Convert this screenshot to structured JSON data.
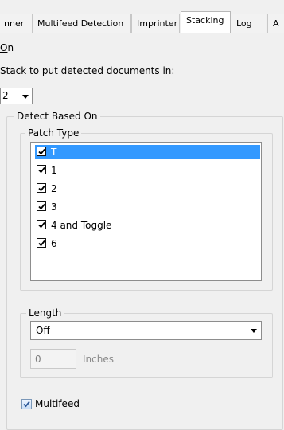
{
  "tabs": [
    {
      "label": "nner"
    },
    {
      "label": "Multifeed Detection"
    },
    {
      "label": "Imprinter"
    },
    {
      "label": "Stacking"
    },
    {
      "label": "Log"
    },
    {
      "label": "A"
    }
  ],
  "on_checkbox": {
    "mnemonic": "O",
    "rest": "n"
  },
  "stack_label": "Stack to put detected documents in:",
  "stack_select": {
    "value": "2"
  },
  "detect_group": {
    "title": "Detect Based On"
  },
  "patch_type": {
    "title": "Patch Type",
    "items": [
      {
        "label": "T",
        "checked": true,
        "selected": true
      },
      {
        "label": "1",
        "checked": true
      },
      {
        "label": "2",
        "checked": true
      },
      {
        "label": "3",
        "checked": true
      },
      {
        "label": "4 and Toggle",
        "checked": true
      },
      {
        "label": "6",
        "checked": true
      }
    ]
  },
  "length": {
    "title": "Length",
    "dropdown_value": "Off",
    "input_value": "0",
    "unit": "Inches"
  },
  "multifeed": {
    "label": "Multifeed",
    "checked": true
  },
  "colors": {
    "selection": "#3399ff",
    "accent_check": "#2b5797"
  }
}
